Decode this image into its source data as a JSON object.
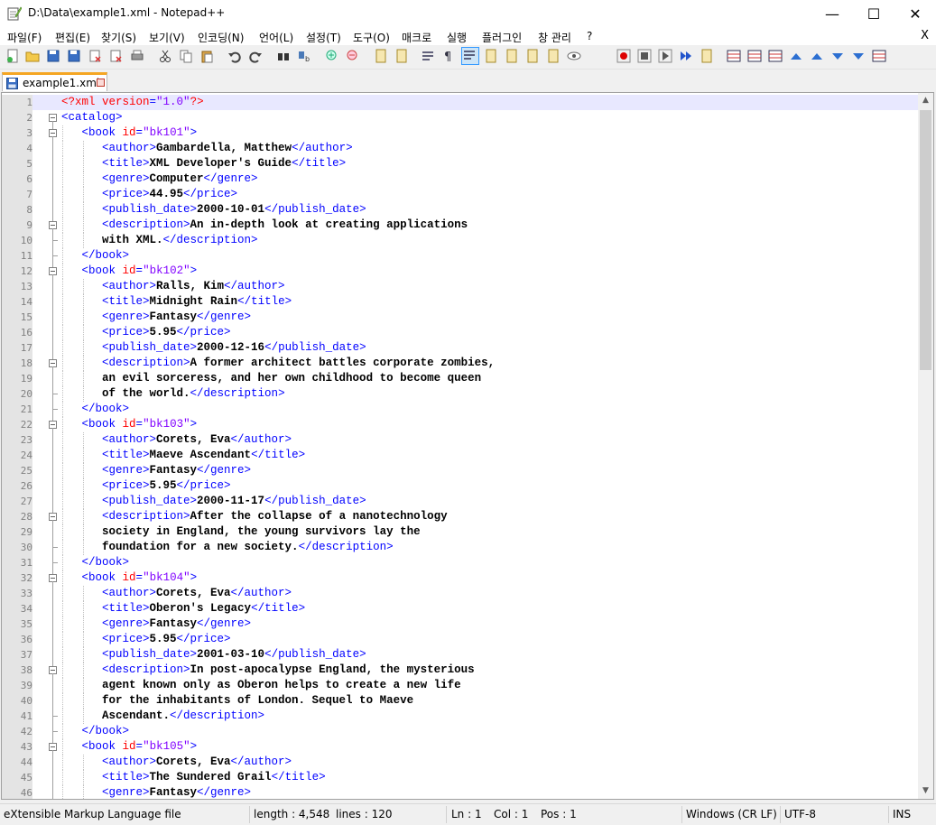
{
  "window": {
    "title": "D:\\Data\\example1.xml - Notepad++",
    "minimize_glyph": "—",
    "maximize_glyph": "☐",
    "close_glyph": "✕"
  },
  "menu": {
    "items": [
      "파일(F)",
      "편집(E)",
      "찾기(S)",
      "보기(V)",
      "인코딩(N)",
      "언어(L)",
      "설정(T)",
      "도구(O)",
      "매크로",
      "실행",
      "플러그인",
      "창 관리",
      "?"
    ],
    "close_glyph": "X"
  },
  "toolbar": {
    "icons": [
      "new-file-icon",
      "open-file-icon",
      "save-icon",
      "save-all-icon",
      "close-icon",
      "close-all-icon",
      "print-icon",
      "cut-icon",
      "copy-icon",
      "paste-icon",
      "undo-icon",
      "redo-icon",
      "find-icon",
      "replace-icon",
      "zoom-in-icon",
      "zoom-out-icon",
      "sync-vertical-icon",
      "sync-horizontal-icon",
      "word-wrap-icon",
      "show-all-chars-icon",
      "indent-guide-icon",
      "udl-icon",
      "doc-map-icon",
      "function-list-icon",
      "folder-workspace-icon",
      "monitor-icon",
      "record-macro-icon",
      "stop-macro-icon",
      "play-macro-icon",
      "run-macro-multiple-icon",
      "save-macro-icon",
      "compare-icon",
      "compare-prev-icon",
      "compare-next-icon",
      "first-diff-icon",
      "prev-diff-icon",
      "next-diff-icon",
      "last-diff-icon",
      "compare-panel-icon"
    ]
  },
  "tab": {
    "label": "example1.xml"
  },
  "editor": {
    "lines": [
      {
        "n": "1",
        "fold": "none",
        "guides": 0,
        "indent": 0,
        "tokens": [
          [
            "pi",
            "<?xml "
          ],
          [
            "attr",
            "version"
          ],
          [
            "tag",
            "="
          ],
          [
            "val",
            "\"1.0\""
          ],
          [
            "pi",
            "?>"
          ]
        ]
      },
      {
        "n": "2",
        "fold": "open",
        "guides": 0,
        "indent": 0,
        "tokens": [
          [
            "tag",
            "<catalog>"
          ]
        ]
      },
      {
        "n": "3",
        "fold": "open",
        "guides": 1,
        "indent": 3,
        "tokens": [
          [
            "tag",
            "<book "
          ],
          [
            "attr",
            "id"
          ],
          [
            "tag",
            "="
          ],
          [
            "val",
            "\"bk101\""
          ],
          [
            "tag",
            ">"
          ]
        ]
      },
      {
        "n": "4",
        "fold": "line",
        "guides": 2,
        "indent": 6,
        "tokens": [
          [
            "tag",
            "<author>"
          ],
          [
            "text",
            "Gambardella, Matthew"
          ],
          [
            "tag",
            "</author>"
          ]
        ]
      },
      {
        "n": "5",
        "fold": "line",
        "guides": 2,
        "indent": 6,
        "tokens": [
          [
            "tag",
            "<title>"
          ],
          [
            "text",
            "XML Developer's Guide"
          ],
          [
            "tag",
            "</title>"
          ]
        ]
      },
      {
        "n": "6",
        "fold": "line",
        "guides": 2,
        "indent": 6,
        "tokens": [
          [
            "tag",
            "<genre>"
          ],
          [
            "text",
            "Computer"
          ],
          [
            "tag",
            "</genre>"
          ]
        ]
      },
      {
        "n": "7",
        "fold": "line",
        "guides": 2,
        "indent": 6,
        "tokens": [
          [
            "tag",
            "<price>"
          ],
          [
            "text",
            "44.95"
          ],
          [
            "tag",
            "</price>"
          ]
        ]
      },
      {
        "n": "8",
        "fold": "line",
        "guides": 2,
        "indent": 6,
        "tokens": [
          [
            "tag",
            "<publish_date>"
          ],
          [
            "text",
            "2000-10-01"
          ],
          [
            "tag",
            "</publish_date>"
          ]
        ]
      },
      {
        "n": "9",
        "fold": "open",
        "guides": 2,
        "indent": 6,
        "tokens": [
          [
            "tag",
            "<description>"
          ],
          [
            "text",
            "An in-depth look at creating applications"
          ]
        ]
      },
      {
        "n": "10",
        "fold": "end",
        "guides": 2,
        "indent": 6,
        "tokens": [
          [
            "text",
            "with XML."
          ],
          [
            "tag",
            "</description>"
          ]
        ]
      },
      {
        "n": "11",
        "fold": "end",
        "guides": 1,
        "indent": 3,
        "tokens": [
          [
            "tag",
            "</book>"
          ]
        ]
      },
      {
        "n": "12",
        "fold": "open",
        "guides": 1,
        "indent": 3,
        "tokens": [
          [
            "tag",
            "<book "
          ],
          [
            "attr",
            "id"
          ],
          [
            "tag",
            "="
          ],
          [
            "val",
            "\"bk102\""
          ],
          [
            "tag",
            ">"
          ]
        ]
      },
      {
        "n": "13",
        "fold": "line",
        "guides": 2,
        "indent": 6,
        "tokens": [
          [
            "tag",
            "<author>"
          ],
          [
            "text",
            "Ralls, Kim"
          ],
          [
            "tag",
            "</author>"
          ]
        ]
      },
      {
        "n": "14",
        "fold": "line",
        "guides": 2,
        "indent": 6,
        "tokens": [
          [
            "tag",
            "<title>"
          ],
          [
            "text",
            "Midnight Rain"
          ],
          [
            "tag",
            "</title>"
          ]
        ]
      },
      {
        "n": "15",
        "fold": "line",
        "guides": 2,
        "indent": 6,
        "tokens": [
          [
            "tag",
            "<genre>"
          ],
          [
            "text",
            "Fantasy"
          ],
          [
            "tag",
            "</genre>"
          ]
        ]
      },
      {
        "n": "16",
        "fold": "line",
        "guides": 2,
        "indent": 6,
        "tokens": [
          [
            "tag",
            "<price>"
          ],
          [
            "text",
            "5.95"
          ],
          [
            "tag",
            "</price>"
          ]
        ]
      },
      {
        "n": "17",
        "fold": "line",
        "guides": 2,
        "indent": 6,
        "tokens": [
          [
            "tag",
            "<publish_date>"
          ],
          [
            "text",
            "2000-12-16"
          ],
          [
            "tag",
            "</publish_date>"
          ]
        ]
      },
      {
        "n": "18",
        "fold": "open",
        "guides": 2,
        "indent": 6,
        "tokens": [
          [
            "tag",
            "<description>"
          ],
          [
            "text",
            "A former architect battles corporate zombies,"
          ]
        ]
      },
      {
        "n": "19",
        "fold": "line",
        "guides": 2,
        "indent": 6,
        "tokens": [
          [
            "text",
            "an evil sorceress, and her own childhood to become queen"
          ]
        ]
      },
      {
        "n": "20",
        "fold": "end",
        "guides": 2,
        "indent": 6,
        "tokens": [
          [
            "text",
            "of the world."
          ],
          [
            "tag",
            "</description>"
          ]
        ]
      },
      {
        "n": "21",
        "fold": "end",
        "guides": 1,
        "indent": 3,
        "tokens": [
          [
            "tag",
            "</book>"
          ]
        ]
      },
      {
        "n": "22",
        "fold": "open",
        "guides": 1,
        "indent": 3,
        "tokens": [
          [
            "tag",
            "<book "
          ],
          [
            "attr",
            "id"
          ],
          [
            "tag",
            "="
          ],
          [
            "val",
            "\"bk103\""
          ],
          [
            "tag",
            ">"
          ]
        ]
      },
      {
        "n": "23",
        "fold": "line",
        "guides": 2,
        "indent": 6,
        "tokens": [
          [
            "tag",
            "<author>"
          ],
          [
            "text",
            "Corets, Eva"
          ],
          [
            "tag",
            "</author>"
          ]
        ]
      },
      {
        "n": "24",
        "fold": "line",
        "guides": 2,
        "indent": 6,
        "tokens": [
          [
            "tag",
            "<title>"
          ],
          [
            "text",
            "Maeve Ascendant"
          ],
          [
            "tag",
            "</title>"
          ]
        ]
      },
      {
        "n": "25",
        "fold": "line",
        "guides": 2,
        "indent": 6,
        "tokens": [
          [
            "tag",
            "<genre>"
          ],
          [
            "text",
            "Fantasy"
          ],
          [
            "tag",
            "</genre>"
          ]
        ]
      },
      {
        "n": "26",
        "fold": "line",
        "guides": 2,
        "indent": 6,
        "tokens": [
          [
            "tag",
            "<price>"
          ],
          [
            "text",
            "5.95"
          ],
          [
            "tag",
            "</price>"
          ]
        ]
      },
      {
        "n": "27",
        "fold": "line",
        "guides": 2,
        "indent": 6,
        "tokens": [
          [
            "tag",
            "<publish_date>"
          ],
          [
            "text",
            "2000-11-17"
          ],
          [
            "tag",
            "</publish_date>"
          ]
        ]
      },
      {
        "n": "28",
        "fold": "open",
        "guides": 2,
        "indent": 6,
        "tokens": [
          [
            "tag",
            "<description>"
          ],
          [
            "text",
            "After the collapse of a nanotechnology"
          ]
        ]
      },
      {
        "n": "29",
        "fold": "line",
        "guides": 2,
        "indent": 6,
        "tokens": [
          [
            "text",
            "society in England, the young survivors lay the"
          ]
        ]
      },
      {
        "n": "30",
        "fold": "end",
        "guides": 2,
        "indent": 6,
        "tokens": [
          [
            "text",
            "foundation for a new society."
          ],
          [
            "tag",
            "</description>"
          ]
        ]
      },
      {
        "n": "31",
        "fold": "end",
        "guides": 1,
        "indent": 3,
        "tokens": [
          [
            "tag",
            "</book>"
          ]
        ]
      },
      {
        "n": "32",
        "fold": "open",
        "guides": 1,
        "indent": 3,
        "tokens": [
          [
            "tag",
            "<book "
          ],
          [
            "attr",
            "id"
          ],
          [
            "tag",
            "="
          ],
          [
            "val",
            "\"bk104\""
          ],
          [
            "tag",
            ">"
          ]
        ]
      },
      {
        "n": "33",
        "fold": "line",
        "guides": 2,
        "indent": 6,
        "tokens": [
          [
            "tag",
            "<author>"
          ],
          [
            "text",
            "Corets, Eva"
          ],
          [
            "tag",
            "</author>"
          ]
        ]
      },
      {
        "n": "34",
        "fold": "line",
        "guides": 2,
        "indent": 6,
        "tokens": [
          [
            "tag",
            "<title>"
          ],
          [
            "text",
            "Oberon's Legacy"
          ],
          [
            "tag",
            "</title>"
          ]
        ]
      },
      {
        "n": "35",
        "fold": "line",
        "guides": 2,
        "indent": 6,
        "tokens": [
          [
            "tag",
            "<genre>"
          ],
          [
            "text",
            "Fantasy"
          ],
          [
            "tag",
            "</genre>"
          ]
        ]
      },
      {
        "n": "36",
        "fold": "line",
        "guides": 2,
        "indent": 6,
        "tokens": [
          [
            "tag",
            "<price>"
          ],
          [
            "text",
            "5.95"
          ],
          [
            "tag",
            "</price>"
          ]
        ]
      },
      {
        "n": "37",
        "fold": "line",
        "guides": 2,
        "indent": 6,
        "tokens": [
          [
            "tag",
            "<publish_date>"
          ],
          [
            "text",
            "2001-03-10"
          ],
          [
            "tag",
            "</publish_date>"
          ]
        ]
      },
      {
        "n": "38",
        "fold": "open",
        "guides": 2,
        "indent": 6,
        "tokens": [
          [
            "tag",
            "<description>"
          ],
          [
            "text",
            "In post-apocalypse England, the mysterious"
          ]
        ]
      },
      {
        "n": "39",
        "fold": "line",
        "guides": 2,
        "indent": 6,
        "tokens": [
          [
            "text",
            "agent known only as Oberon helps to create a new life"
          ]
        ]
      },
      {
        "n": "40",
        "fold": "line",
        "guides": 2,
        "indent": 6,
        "tokens": [
          [
            "text",
            "for the inhabitants of London. Sequel to Maeve"
          ]
        ]
      },
      {
        "n": "41",
        "fold": "end",
        "guides": 2,
        "indent": 6,
        "tokens": [
          [
            "text",
            "Ascendant."
          ],
          [
            "tag",
            "</description>"
          ]
        ]
      },
      {
        "n": "42",
        "fold": "end",
        "guides": 1,
        "indent": 3,
        "tokens": [
          [
            "tag",
            "</book>"
          ]
        ]
      },
      {
        "n": "43",
        "fold": "open",
        "guides": 1,
        "indent": 3,
        "tokens": [
          [
            "tag",
            "<book "
          ],
          [
            "attr",
            "id"
          ],
          [
            "tag",
            "="
          ],
          [
            "val",
            "\"bk105\""
          ],
          [
            "tag",
            ">"
          ]
        ]
      },
      {
        "n": "44",
        "fold": "line",
        "guides": 2,
        "indent": 6,
        "tokens": [
          [
            "tag",
            "<author>"
          ],
          [
            "text",
            "Corets, Eva"
          ],
          [
            "tag",
            "</author>"
          ]
        ]
      },
      {
        "n": "45",
        "fold": "line",
        "guides": 2,
        "indent": 6,
        "tokens": [
          [
            "tag",
            "<title>"
          ],
          [
            "text",
            "The Sundered Grail"
          ],
          [
            "tag",
            "</title>"
          ]
        ]
      },
      {
        "n": "46",
        "fold": "line",
        "guides": 2,
        "indent": 6,
        "tokens": [
          [
            "tag",
            "<genre>"
          ],
          [
            "text",
            "Fantasy"
          ],
          [
            "tag",
            "</genre>"
          ]
        ]
      }
    ]
  },
  "status": {
    "file_type": "eXtensible Markup Language file",
    "length": "length : 4,548",
    "lines": "lines : 120",
    "ln": "Ln : 1",
    "col": "Col : 1",
    "pos": "Pos : 1",
    "eol": "Windows (CR LF)",
    "encoding": "UTF-8",
    "mode": "INS"
  },
  "colors": {
    "current_line": "#e8e8ff",
    "tag": "#0000ff",
    "attribute": "#ff0000",
    "value": "#8000ff",
    "tab_accent": "#f5a623"
  }
}
